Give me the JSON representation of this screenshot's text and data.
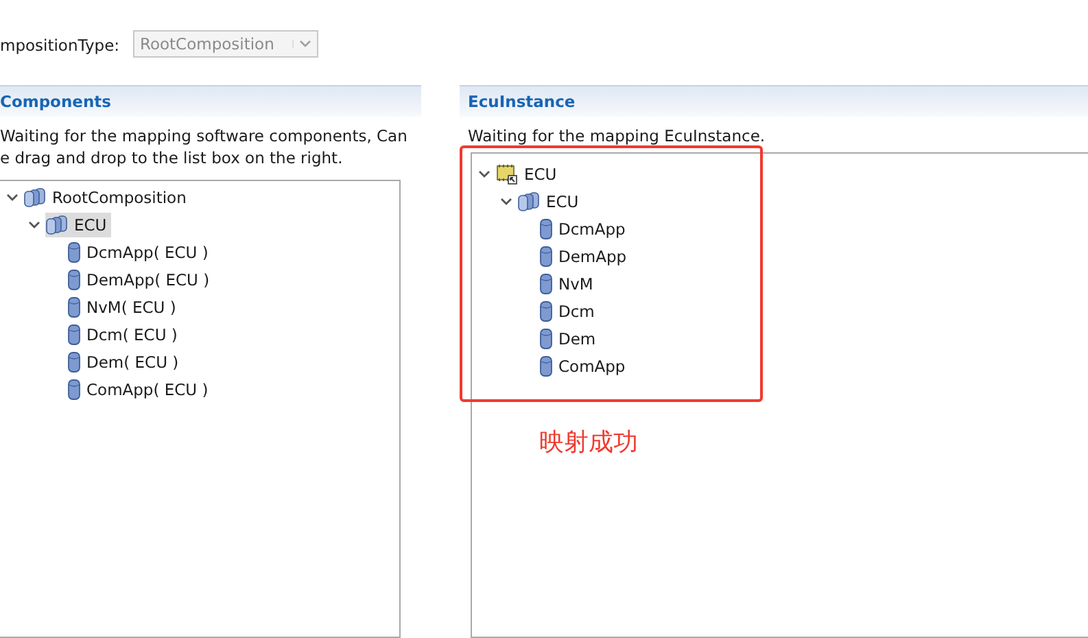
{
  "composition_type": {
    "label": "mpositionType:",
    "value": "RootComposition",
    "disabled": true
  },
  "panels": [
    {
      "title": "Components",
      "description": [
        "Waiting for the mapping software components, Can",
        "e drag and drop to the list box on the right."
      ],
      "tree": [
        {
          "label": "RootComposition",
          "kind": "composition",
          "expanded": true,
          "selected": false,
          "children": [
            {
              "label": "ECU",
              "kind": "composition",
              "expanded": true,
              "selected": true,
              "children": [
                {
                  "label": "DcmApp( ECU )",
                  "kind": "component",
                  "selected": false
                },
                {
                  "label": "DemApp( ECU )",
                  "kind": "component",
                  "selected": false
                },
                {
                  "label": "NvM( ECU )",
                  "kind": "component",
                  "selected": false
                },
                {
                  "label": "Dcm( ECU )",
                  "kind": "component",
                  "selected": false
                },
                {
                  "label": "Dem( ECU )",
                  "kind": "component",
                  "selected": false
                },
                {
                  "label": "ComApp( ECU )",
                  "kind": "component",
                  "selected": false
                }
              ]
            }
          ]
        }
      ]
    },
    {
      "title": "EcuInstance",
      "description": [
        "Waiting for the mapping EcuInstance."
      ],
      "tree": [
        {
          "label": "ECU",
          "kind": "ecu",
          "expanded": true,
          "selected": false,
          "children": [
            {
              "label": "ECU",
              "kind": "composition",
              "expanded": true,
              "selected": false,
              "children": [
                {
                  "label": "DcmApp",
                  "kind": "component",
                  "selected": false
                },
                {
                  "label": "DemApp",
                  "kind": "component",
                  "selected": false
                },
                {
                  "label": "NvM",
                  "kind": "component",
                  "selected": false
                },
                {
                  "label": "Dcm",
                  "kind": "component",
                  "selected": false
                },
                {
                  "label": "Dem",
                  "kind": "component",
                  "selected": false
                },
                {
                  "label": "ComApp",
                  "kind": "component",
                  "selected": false
                }
              ]
            }
          ]
        }
      ]
    }
  ],
  "annotation": {
    "text": "映射成功"
  }
}
